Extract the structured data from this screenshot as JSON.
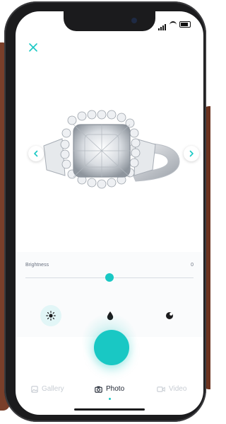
{
  "colors": {
    "accent": "#19c8c4",
    "text_muted": "#6a7280",
    "text_dark": "#1d2330",
    "tab_inactive": "#c7ccd3",
    "icon_dark": "#1b1b1d"
  },
  "status_bar": {
    "time": "",
    "icons": [
      "signal-icon",
      "wifi-icon",
      "battery-icon"
    ]
  },
  "header": {
    "close_icon": "close-icon"
  },
  "photo": {
    "subject": "diamond ring",
    "prev_icon": "chevron-left-icon",
    "next_icon": "chevron-right-icon"
  },
  "brightness": {
    "label": "Brightness",
    "value": "0",
    "level": 0.5
  },
  "tools": [
    {
      "icon": "sun-icon",
      "active": true
    },
    {
      "icon": "drop-icon",
      "active": false
    },
    {
      "icon": "contrast-icon",
      "active": false
    }
  ],
  "tabs": [
    {
      "label": "Gallery",
      "icon": "gallery-icon",
      "active": false
    },
    {
      "label": "Photo",
      "icon": "camera-icon",
      "active": true
    },
    {
      "label": "Video",
      "icon": "video-icon",
      "active": false
    }
  ]
}
